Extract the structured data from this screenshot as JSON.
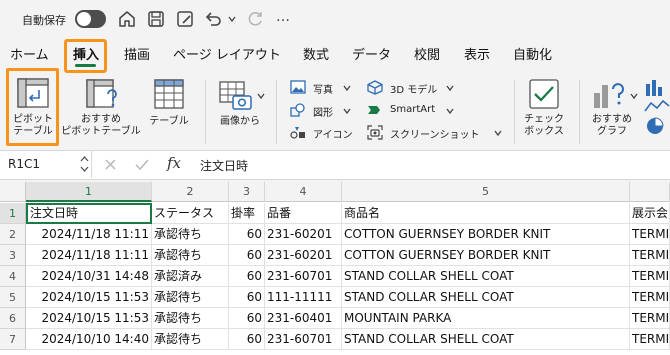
{
  "titlebar": {
    "autosave_label": "自動保存",
    "autosave_state": "off",
    "more_label": "…"
  },
  "tabs": [
    "ホーム",
    "挿入",
    "描画",
    "ページ レイアウト",
    "数式",
    "データ",
    "校閲",
    "表示",
    "自動化"
  ],
  "active_tab": "挿入",
  "ribbon": {
    "pivot_label_1": "ピボット",
    "pivot_label_2": "テーブル",
    "recommended_pivot_1": "おすすめ",
    "recommended_pivot_2": "ピボットテーブル",
    "table_label": "テーブル",
    "image_label": "画像から",
    "pictures": "写真",
    "shapes": "図形",
    "icons": "アイコン",
    "models_3d": "3D モデル",
    "smartart": "SmartArt",
    "screenshot": "スクリーンショット",
    "checkbox_1": "チェック",
    "checkbox_2": "ボックス",
    "rec_chart_1": "おすすめ",
    "rec_chart_2": "グラフ"
  },
  "formula_bar": {
    "name_box": "R1C1",
    "fx": "fx",
    "value": "注文日時"
  },
  "columns": [
    "1",
    "2",
    "3",
    "4",
    "5",
    ""
  ],
  "row_numbers": [
    "1",
    "2",
    "3",
    "4",
    "5",
    "6",
    "7"
  ],
  "rows": [
    [
      "注文日時",
      "ステータス",
      "掛率",
      "品番",
      "商品名",
      "展示会"
    ],
    [
      "2024/11/18 11:11",
      "承認待ち",
      "60",
      "231-60201",
      "COTTON GUERNSEY BORDER KNIT",
      "TERMI"
    ],
    [
      "2024/11/18 11:11",
      "承認待ち",
      "60",
      "231-60201",
      "COTTON GUERNSEY BORDER KNIT",
      "TERMI"
    ],
    [
      "2024/10/31 14:48",
      "承認済み",
      "60",
      "231-60701",
      "STAND COLLAR SHELL COAT",
      "TERMI"
    ],
    [
      "2024/10/15 11:53",
      "承認待ち",
      "60",
      "111-11111",
      "STAND COLLAR SHELL COAT",
      "TERMI"
    ],
    [
      "2024/10/15 11:53",
      "承認待ち",
      "60",
      "231-60401",
      "MOUNTAIN PARKA",
      "TERMI"
    ],
    [
      "2024/10/10 14:40",
      "承認待ち",
      "60",
      "231-60701",
      "STAND COLLAR SHELL COAT",
      "TERMI"
    ]
  ],
  "colors": {
    "accent": "#1a7a43",
    "highlight": "#f7941d"
  }
}
